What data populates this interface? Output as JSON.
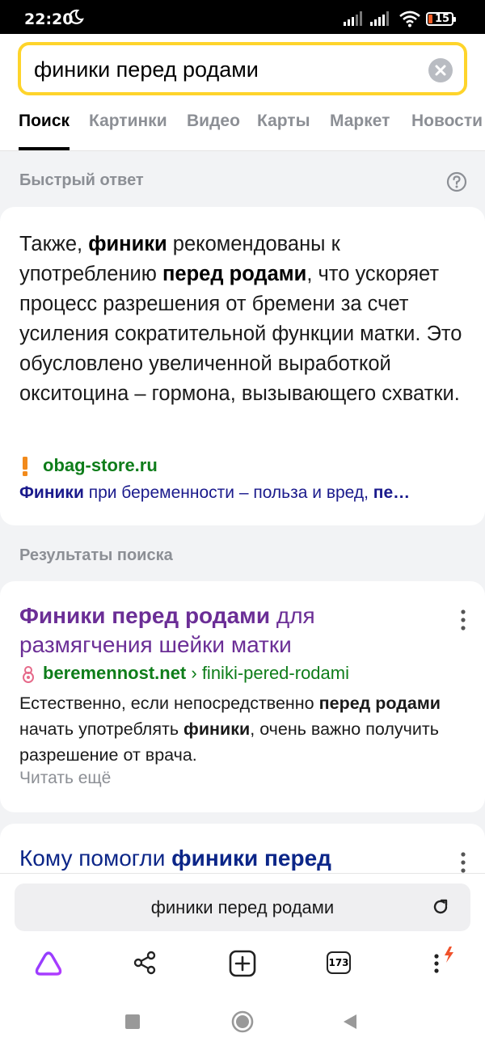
{
  "status": {
    "time": "22:20",
    "battery": "15"
  },
  "search": {
    "query": "финики перед родами"
  },
  "tabs": [
    {
      "label": "Поиск"
    },
    {
      "label": "Картинки"
    },
    {
      "label": "Видео"
    },
    {
      "label": "Карты"
    },
    {
      "label": "Маркет"
    },
    {
      "label": "Новости"
    }
  ],
  "quick_answer": {
    "label": "Быстрый ответ",
    "source_domain": "obag-store.ru",
    "source_title_bold": "Финики",
    "source_title_rest": " при беременности – польза и вред, ",
    "source_title_bold2": "пе…"
  },
  "results_label": "Результаты поиска",
  "results": [
    {
      "title_bold": "Финики перед родами",
      "title_rest": " для размягчения шейки матки",
      "domain": "beremennost.net",
      "path": " › finiki-pered-rodami",
      "read_more": "Читать ещё"
    },
    {
      "title_rest": "Кому помогли ",
      "title_bold": "финики перед"
    }
  ],
  "bottom": {
    "url_text": "финики перед родами",
    "tabs_count": "173"
  }
}
